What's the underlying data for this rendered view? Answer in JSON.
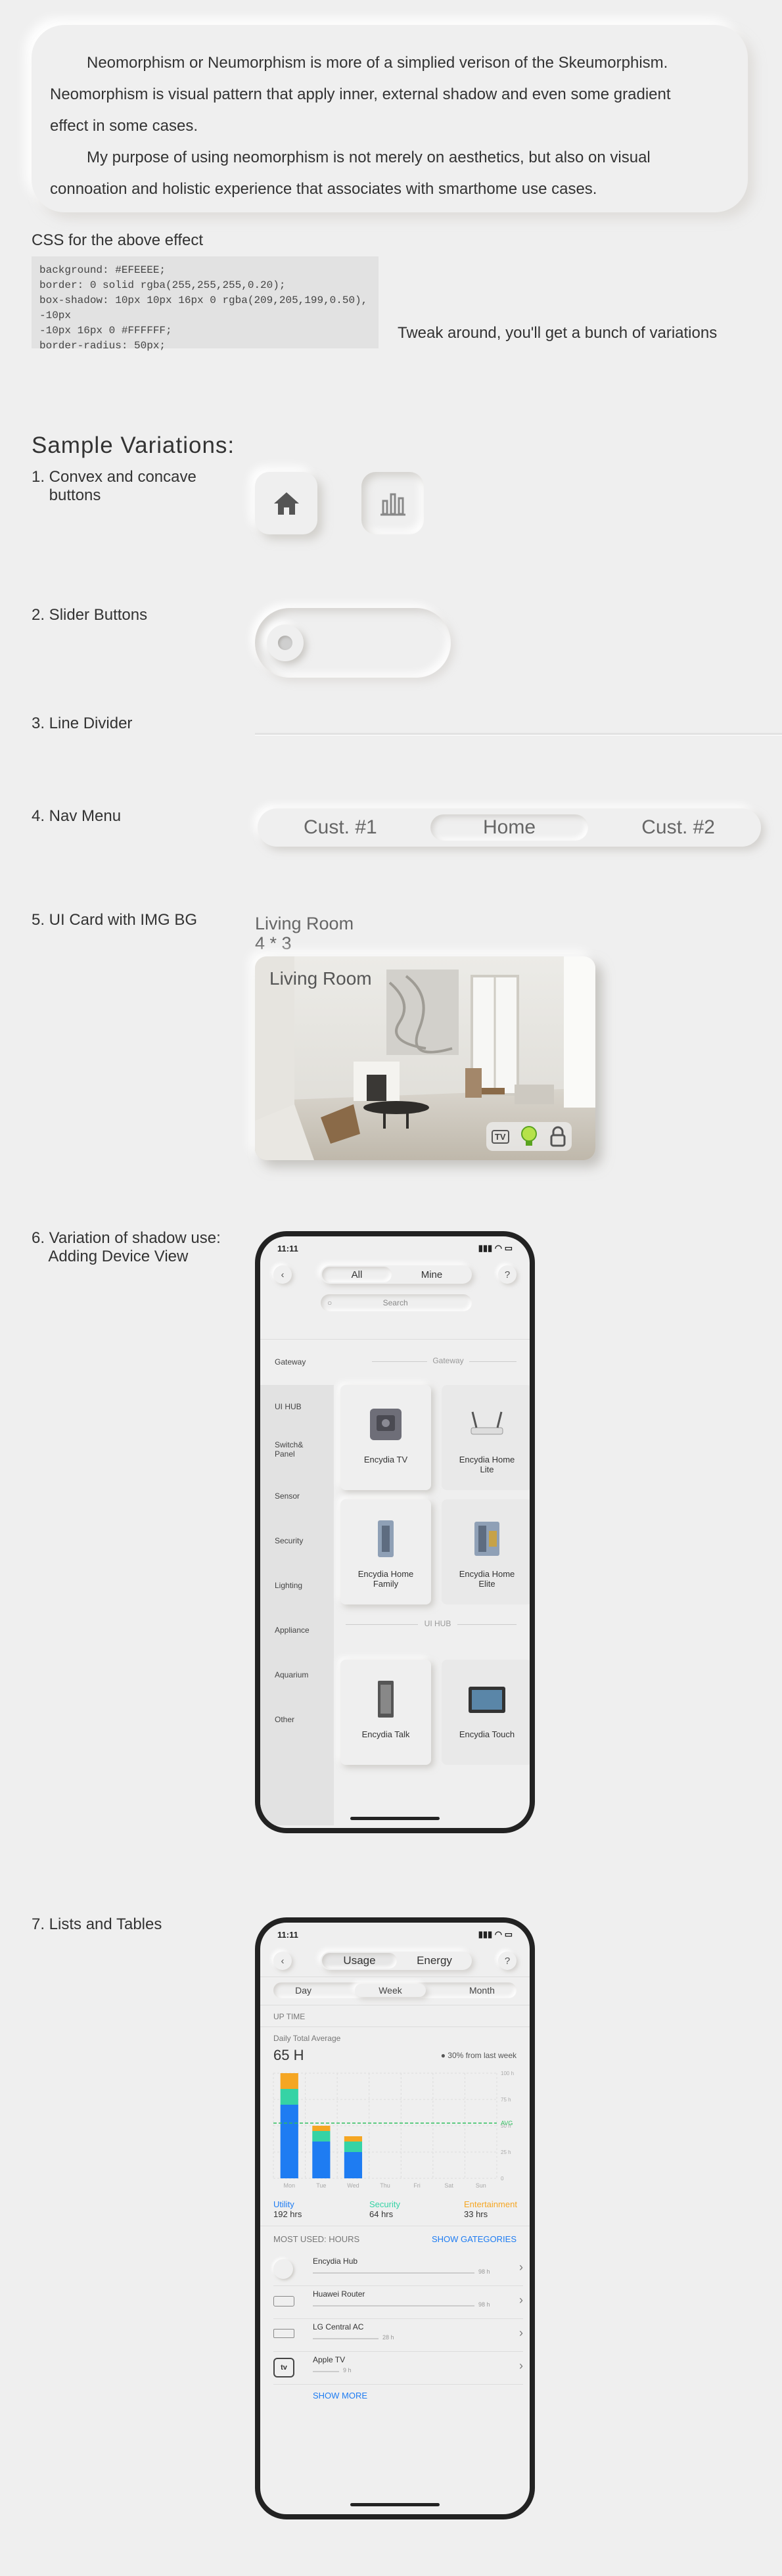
{
  "intro": {
    "line1": "Neomorphism or Neumorphism is more of a simplied verison of the Skeumorphism.",
    "line2": "Neomorphism is visual pattern that apply inner, external shadow and even some gradient",
    "line3": "effect in some cases.",
    "line4": "My purpose of using neomorphism is not merely on aesthetics, but also on visual",
    "line5": "connoation and holistic experience that associates with smarthome use cases."
  },
  "css_section": {
    "title": "CSS for the above effect",
    "code": "background: #EFEEEE;\nborder: 0 solid rgba(255,255,255,0.20);\nbox-shadow: 10px 10px 16px 0 rgba(209,205,199,0.50), -10px\n-10px 16px 0 #FFFFFF;\nborder-radius: 50px;",
    "tweak": "Tweak around, you'll get a bunch of variations"
  },
  "variations": {
    "title": "Sample Variations:",
    "item1": "1. Convex and concave\n    buttons",
    "item2": "2. Slider Buttons",
    "item3": "3. Line Divider",
    "item4": "4. Nav Menu",
    "item5": "5. UI Card with IMG BG",
    "item6": "6. Variation of shadow use:\n    Adding Device View",
    "item7": "7.  Lists and Tables"
  },
  "nav_menu": {
    "left": "Cust. #1",
    "center": "Home",
    "right": "Cust. #2"
  },
  "ui_card": {
    "caption": "Living Room\n4 * 3",
    "title": "Living Room",
    "tv_label": "TV"
  },
  "phone1": {
    "time": "11:11",
    "tab_all": "All",
    "tab_mine": "Mine",
    "help": "?",
    "search_placeholder": "Search",
    "sidebar": [
      "Gateway",
      "UI HUB",
      "Switch&\nPanel",
      "Sensor",
      "Security",
      "Lighting",
      "Appliance",
      "Aquarium",
      "Other"
    ],
    "section_gateway": "Gateway",
    "section_uihub": "UI HUB",
    "devices": [
      "Encydia TV",
      "Encydia Home\nLite",
      "Encydia Home\nFamily",
      "Encydia Home\nElite",
      "Encydia Talk",
      "Encydia Touch"
    ]
  },
  "phone2": {
    "time": "11:11",
    "tab_usage": "Usage",
    "tab_energy": "Energy",
    "help": "?",
    "periods": [
      "Day",
      "Week",
      "Month"
    ],
    "uptime_label": "UP TIME",
    "daily_label": "Daily Total Average",
    "daily_value": "65 H",
    "change": "30% from last week",
    "avg_label": "AVG",
    "legend": [
      {
        "name": "Utility",
        "value": "192 hrs",
        "color": "#1e7cf2"
      },
      {
        "name": "Security",
        "value": "64 hrs",
        "color": "#35d3a5"
      },
      {
        "name": "Entertainment",
        "value": "33 hrs",
        "color": "#f5a623"
      }
    ],
    "most_used": "MOST USED: HOURS",
    "show_categories": "SHOW GATEGORIES",
    "rows": [
      {
        "name": "Encydia Hub",
        "value": "98 h"
      },
      {
        "name": "Huawei Router",
        "value": "98 h"
      },
      {
        "name": "LG Central AC",
        "value": "28 h"
      },
      {
        "name": "Apple TV",
        "value": "9 h"
      }
    ],
    "apple_tv_icon": "tv",
    "show_more": "SHOW MORE"
  },
  "chart_data": {
    "type": "bar",
    "categories": [
      "Mon",
      "Tue",
      "Wed",
      "Thu",
      "Fri",
      "Sat",
      "Sun"
    ],
    "series": [
      {
        "name": "Utility",
        "values": [
          14,
          7,
          5,
          0,
          0,
          0,
          0
        ]
      },
      {
        "name": "Security",
        "values": [
          3,
          2,
          2,
          0,
          0,
          0,
          0
        ]
      },
      {
        "name": "Entertainment",
        "values": [
          3,
          1,
          1,
          0,
          0,
          0,
          0
        ]
      }
    ],
    "y_ticks": [
      "100 h",
      "75 h",
      "50 h",
      "25 h",
      "0"
    ],
    "ylim": [
      0,
      20
    ],
    "avg_line": 10.5,
    "colors": [
      "#1e7cf2",
      "#35d3a5",
      "#f5a623"
    ]
  }
}
